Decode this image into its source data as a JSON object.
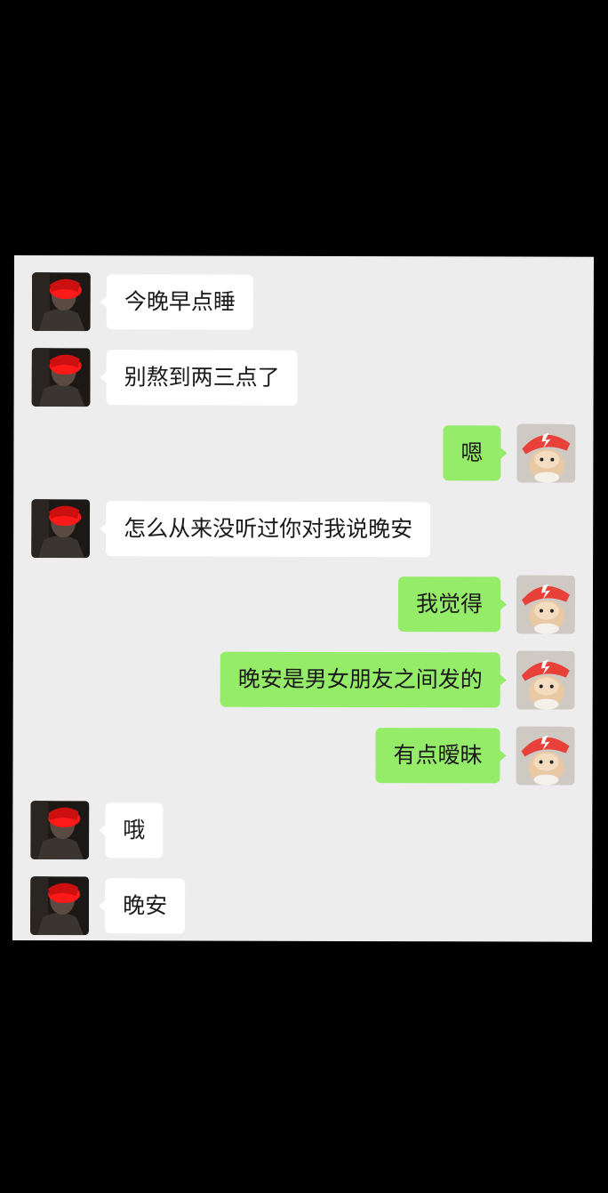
{
  "conversation": {
    "messages": [
      {
        "from": "contact",
        "text": "今晚早点睡"
      },
      {
        "from": "contact",
        "text": "别熬到两三点了"
      },
      {
        "from": "me",
        "text": "嗯"
      },
      {
        "from": "contact",
        "text": "怎么从来没听过你对我说晚安"
      },
      {
        "from": "me",
        "text": "我觉得"
      },
      {
        "from": "me",
        "text": "晚安是男女朋友之间发的"
      },
      {
        "from": "me",
        "text": "有点暧昧"
      },
      {
        "from": "contact",
        "text": "哦"
      },
      {
        "from": "contact",
        "text": "晚安"
      }
    ]
  },
  "avatars": {
    "contact": {
      "icon": "person-photo-avatar",
      "highlight_color": "#ff1a1a"
    },
    "me": {
      "icon": "cartoon-character-avatar",
      "cap_color": "#e8413a"
    }
  },
  "colors": {
    "panel_background": "#ededed",
    "incoming_bubble": "#ffffff",
    "outgoing_bubble": "#95ec69",
    "outer_background": "#000000"
  }
}
